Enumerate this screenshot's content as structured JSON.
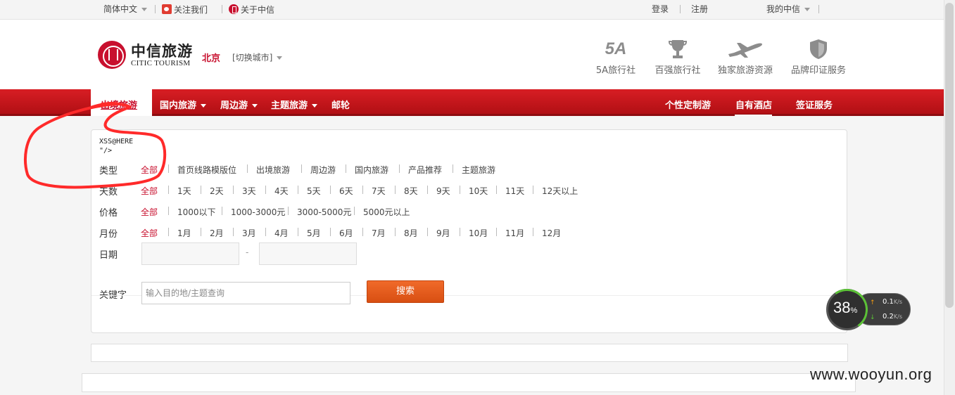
{
  "topbar": {
    "language": "简体中文",
    "follow_us": "关注我们",
    "about": "关于中信",
    "login": "登录",
    "register": "注册",
    "my_citic": "我的中信"
  },
  "header": {
    "logo_cn": "中信旅游",
    "logo_en": "CITIC TOURISM",
    "city": "北京",
    "switch_city": "[切换城市]",
    "features": [
      {
        "icon": "5a-icon",
        "label": "5A旅行社"
      },
      {
        "icon": "trophy-icon",
        "label": "百强旅行社"
      },
      {
        "icon": "airplane-icon",
        "label": "独家旅游资源"
      },
      {
        "icon": "shield-icon",
        "label": "品牌印证服务"
      }
    ],
    "badge_5a": "5A"
  },
  "nav": {
    "items": [
      "出境旅游",
      "国内旅游",
      "周边游",
      "主题旅游",
      "邮轮"
    ],
    "right_items": [
      "个性定制游",
      "自有酒店",
      "签证服务"
    ]
  },
  "filters": {
    "xss_text": "XSS@HERE\n\"/>",
    "type": {
      "label": "类型",
      "options": [
        "全部",
        "首页线路模版位",
        "出境旅游",
        "周边游",
        "国内旅游",
        "产品推荐",
        "主题旅游"
      ]
    },
    "days": {
      "label": "天数",
      "options": [
        "全部",
        "1天",
        "2天",
        "3天",
        "4天",
        "5天",
        "6天",
        "7天",
        "8天",
        "9天",
        "10天",
        "11天",
        "12天以上"
      ]
    },
    "price": {
      "label": "价格",
      "options": [
        "全部",
        "1000以下",
        "1000-3000元",
        "3000-5000元",
        "5000元以上"
      ]
    },
    "month": {
      "label": "月份",
      "options": [
        "全部",
        "1月",
        "2月",
        "3月",
        "4月",
        "5月",
        "6月",
        "7月",
        "8月",
        "9月",
        "10月",
        "11月",
        "12月"
      ]
    },
    "date": {
      "label": "日期",
      "dash": "-"
    },
    "keyword": {
      "label": "关键字",
      "placeholder": "输入目的地/主题查询"
    },
    "search_button": "搜索"
  },
  "speed_widget": {
    "percent": "38",
    "percent_sign": "%",
    "upload": "0.1",
    "download": "0.2",
    "unit": "K/s"
  },
  "watermark": "www.wooyun.org",
  "colors": {
    "brand_red": "#c8102e",
    "nav_red": "#d81e24",
    "search_orange": "#e85c1c",
    "scribble": "#ff2a2a"
  }
}
